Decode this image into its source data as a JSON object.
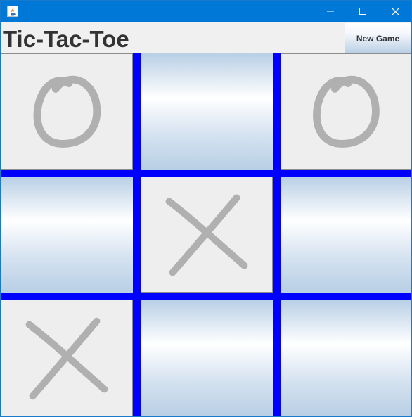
{
  "window": {
    "title": "",
    "icon": "java-icon"
  },
  "header": {
    "title": "Tic-Tac-Toe",
    "new_game_label": "New Game"
  },
  "board": {
    "cells": [
      "O",
      "",
      "O",
      "",
      "X",
      "",
      "X",
      "",
      ""
    ]
  },
  "colors": {
    "title_bar": "#0078d7",
    "grid_lines": "#0000ff",
    "marks": "#b0b0b0",
    "filled_cell": "#eeeeee",
    "empty_cell_gradient": [
      "#b8cfe5",
      "#ffffff"
    ]
  }
}
